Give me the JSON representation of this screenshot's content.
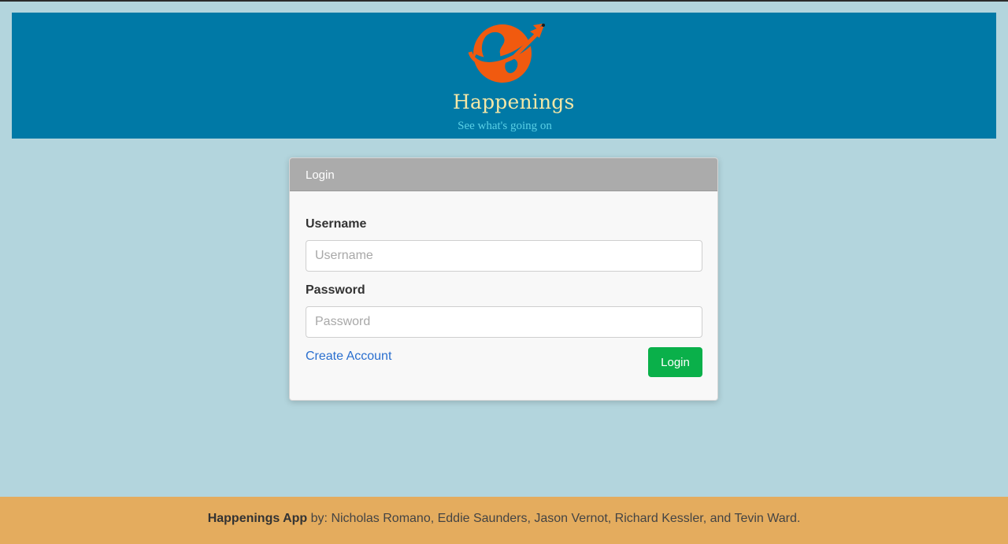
{
  "banner": {
    "brand_name": "Happenings",
    "tagline": "See what's going on",
    "logo_icon": "globe-airplane-icon",
    "colors": {
      "background": "#0079a6",
      "logo": "#f15a0f"
    }
  },
  "login_card": {
    "header_title": "Login",
    "username": {
      "label": "Username",
      "placeholder": "Username",
      "value": ""
    },
    "password": {
      "label": "Password",
      "placeholder": "Password",
      "value": ""
    },
    "create_account_label": "Create Account",
    "login_button_label": "Login",
    "colors": {
      "header": "#ababab",
      "button": "#0ab04a",
      "link": "#2a6fcf"
    }
  },
  "footer": {
    "app_name": "Happenings App",
    "credits": " by: Nicholas Romano, Eddie Saunders, Jason Vernot, Richard Kessler, and Tevin Ward.",
    "color": "#e4ac5e"
  },
  "page": {
    "background": "#b3d5dd"
  }
}
